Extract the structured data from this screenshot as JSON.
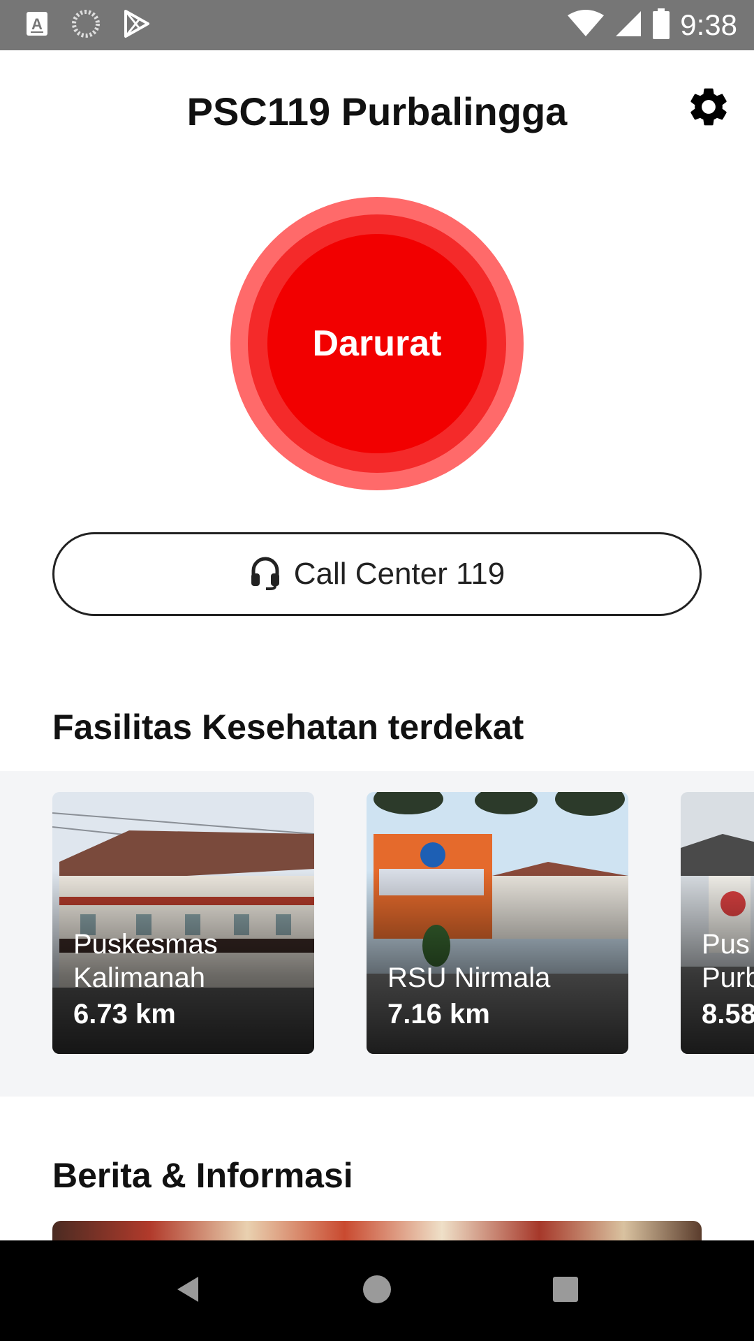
{
  "status_bar": {
    "time": "9:38",
    "left_icons": [
      "keyboard-a-icon",
      "loading-icon",
      "play-store-icon"
    ],
    "right_icons": [
      "wifi-icon",
      "signal-icon",
      "battery-icon"
    ]
  },
  "app_bar": {
    "title": "PSC119 Purbalingga",
    "settings_icon": "gear-icon"
  },
  "emergency": {
    "label": "Darurat",
    "colors": {
      "outer": "#ff6a6a",
      "mid": "#f42a2a",
      "inner": "#f20000"
    }
  },
  "call_center": {
    "label": "Call Center 119",
    "icon": "headset-icon"
  },
  "facilities": {
    "title": "Fasilitas Kesehatan terdekat",
    "items": [
      {
        "name": "Puskesmas\nKalimanah",
        "distance": "6.73 km"
      },
      {
        "name": "RSU Nirmala",
        "distance": "7.16 km"
      },
      {
        "name": "Pus\nPurb",
        "distance": "8.58"
      }
    ]
  },
  "news": {
    "title": "Berita & Informasi"
  },
  "nav_bar": {
    "buttons": [
      "back-icon",
      "home-icon",
      "recents-icon"
    ]
  }
}
